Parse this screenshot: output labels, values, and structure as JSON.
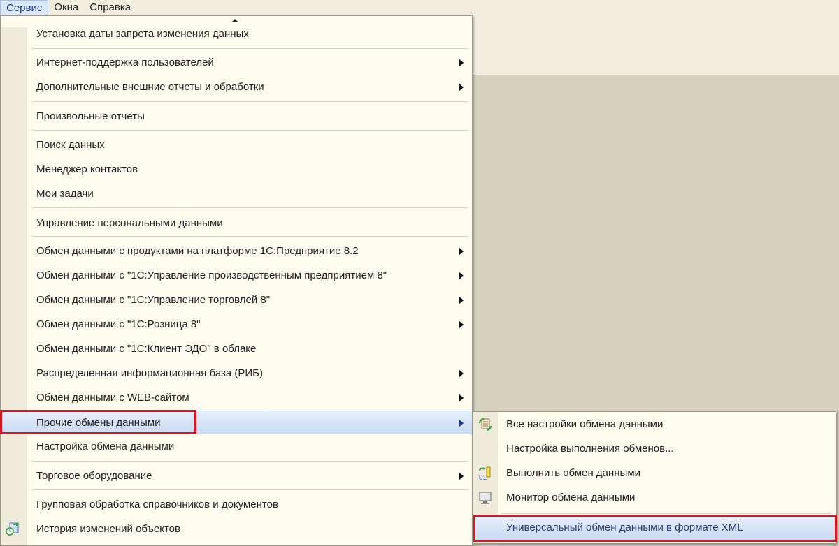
{
  "menubar": {
    "items": [
      "Сервис",
      "Окна",
      "Справка"
    ],
    "active": "Сервис"
  },
  "menu": {
    "items": [
      {
        "label": "Установка даты запрета изменения данных",
        "submenu": false
      },
      {
        "label": "Интернет-поддержка пользователей",
        "submenu": true
      },
      {
        "label": "Дополнительные внешние отчеты и обработки",
        "submenu": true
      },
      {
        "label": "Произвольные отчеты",
        "submenu": false
      },
      {
        "label": "Поиск данных",
        "submenu": false
      },
      {
        "label": "Менеджер контактов",
        "submenu": false
      },
      {
        "label": "Мои задачи",
        "submenu": false
      },
      {
        "label": "Управление персональными данными",
        "submenu": false
      },
      {
        "label": "Обмен данными с продуктами на платформе 1С:Предприятие 8.2",
        "submenu": true
      },
      {
        "label": "Обмен данными с \"1С:Управление производственным предприятием 8\"",
        "submenu": true
      },
      {
        "label": "Обмен данными с \"1С:Управление торговлей 8\"",
        "submenu": true
      },
      {
        "label": "Обмен данными с \"1С:Розница 8\"",
        "submenu": true
      },
      {
        "label": "Обмен данными с \"1С:Клиент ЭДО\" в облаке",
        "submenu": false
      },
      {
        "label": "Распределенная информационная база (РИБ)",
        "submenu": true
      },
      {
        "label": "Обмен данными с WEB-сайтом",
        "submenu": true
      },
      {
        "label": "Прочие обмены данными",
        "submenu": true,
        "highlighted": true
      },
      {
        "label": "Настройка обмена данными",
        "submenu": false
      },
      {
        "label": "Торговое оборудование",
        "submenu": true
      },
      {
        "label": "Групповая обработка справочников и документов",
        "submenu": false
      },
      {
        "label": "История изменений объектов",
        "submenu": false,
        "icon": "history-icon"
      }
    ]
  },
  "submenu": {
    "items": [
      {
        "label": "Все настройки обмена данными",
        "icon": "exchange-settings-icon"
      },
      {
        "label": "Настройка выполнения обменов..."
      },
      {
        "label": "Выполнить обмен данными",
        "icon": "run-exchange-icon"
      },
      {
        "label": "Монитор обмена данными",
        "icon": "monitor-icon"
      },
      {
        "label": "Универсальный обмен данными в формате XML",
        "highlighted": true
      }
    ]
  },
  "colors": {
    "highlight_box": "#e0141e",
    "menu_bg": "#fffbef"
  }
}
